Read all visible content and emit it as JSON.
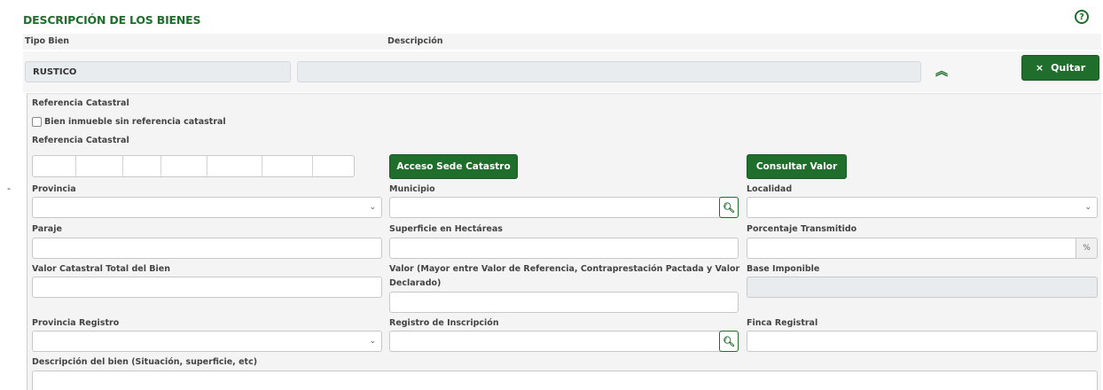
{
  "section": {
    "title": "DESCRIPCIÓN DE LOS BIENES",
    "help_icon": "question-circle-icon"
  },
  "columns": {
    "tipo_bien": "Tipo Bien",
    "descripcion": "Descripción"
  },
  "row": {
    "tipo_bien_value": "RUSTICO",
    "descripcion_value": "",
    "collapse_icon": "chevron-double-up-icon",
    "collapse_glyph": "︽"
  },
  "actions": {
    "quitar_label": "Quitar",
    "quitar_icon": "×",
    "acceso_label": "Acceso Sede Catastro",
    "consultar_label": "Consultar Valor"
  },
  "form": {
    "ref_catastral_heading": "Referencia Catastral",
    "sin_ref_label": "Bien inmueble sin referencia catastral",
    "ref_catastral_label": "Referencia Catastral",
    "provincia": "Provincia",
    "municipio": "Municipio",
    "localidad": "Localidad",
    "paraje": "Paraje",
    "superficie": "Superficie en Hectáreas",
    "porcentaje": "Porcentaje Transmitido",
    "porcentaje_addon": "%",
    "valor_catastral": "Valor Catastral Total del Bien",
    "valor_line1": "Valor (Mayor entre Valor de Referencia, Contraprestación Pactada y Valor",
    "valor_line2": "Declarado)",
    "base_imponible": "Base Imponible",
    "provincia_registro": "Provincia Registro",
    "registro_inscripcion": "Registro de Inscripción",
    "finca_registral": "Finca Registral",
    "descripcion_bien": "Descripción del bien (Situación, superficie, etc)"
  },
  "misc": {
    "dash": "-",
    "select_caret": "⌄",
    "search_glyph": "🔍︎",
    "help_glyph": "?"
  },
  "colors": {
    "brand_green": "#1f6e2b"
  }
}
